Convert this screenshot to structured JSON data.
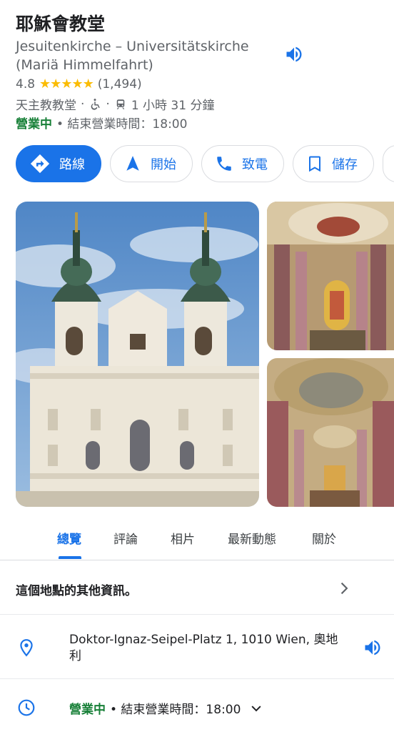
{
  "place": {
    "name": "耶穌會教堂",
    "subtitle": "Jesuitenkirche – Universitätskirche (Mariä Himmelfahrt)",
    "rating": "4.8",
    "stars": "★★★★★",
    "review_count": "(1,494)",
    "category": "天主教教堂",
    "separator": "·",
    "transit_time": "1 小時 31 分鐘",
    "open_status": "營業中",
    "closing_text": "• 結束營業時間：18:00"
  },
  "actions": [
    {
      "label": "路線",
      "icon": "directions-icon"
    },
    {
      "label": "開始",
      "icon": "navigation-arrow-icon"
    },
    {
      "label": "致電",
      "icon": "phone-icon"
    },
    {
      "label": "儲存",
      "icon": "bookmark-icon"
    }
  ],
  "tabs": [
    "總覽",
    "評論",
    "相片",
    "最新動態",
    "關於"
  ],
  "details": {
    "more_info": "這個地點的其他資訊。",
    "address": "Doktor-Ignaz-Seipel-Platz 1, 1010 Wien, 奧地利",
    "hours_status": "營業中",
    "hours_text": "• 結束營業時間：18:00"
  },
  "colors": {
    "accent": "#1a73e8",
    "open": "#188038",
    "star": "#fbbc04"
  }
}
